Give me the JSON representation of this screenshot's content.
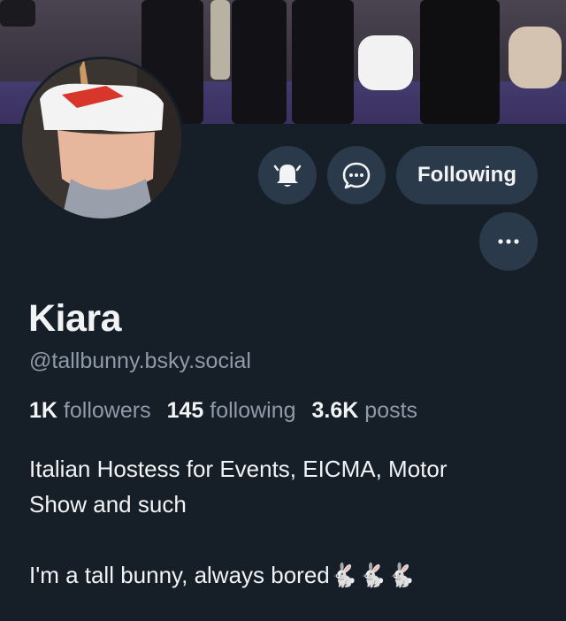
{
  "profile": {
    "display_name": "Kiara",
    "handle": "@tallbunny.bsky.social",
    "stats": {
      "followers_count": "1K",
      "followers_label": "followers",
      "following_count": "145",
      "following_label": "following",
      "posts_count": "3.6K",
      "posts_label": "posts"
    },
    "bio_line1": "Italian Hostess for Events, EICMA, Motor",
    "bio_line2": "Show and such",
    "bio_line3": "I'm a tall bunny, always bored🐇🐇🐇"
  },
  "actions": {
    "following_label": "Following",
    "notify_icon": "bell-icon",
    "message_icon": "chat-bubble-icon",
    "more_icon": "more-horizontal-icon"
  },
  "colors": {
    "background": "#161e27",
    "button_bg": "#2b3a4a",
    "muted_text": "#8f9baa"
  }
}
